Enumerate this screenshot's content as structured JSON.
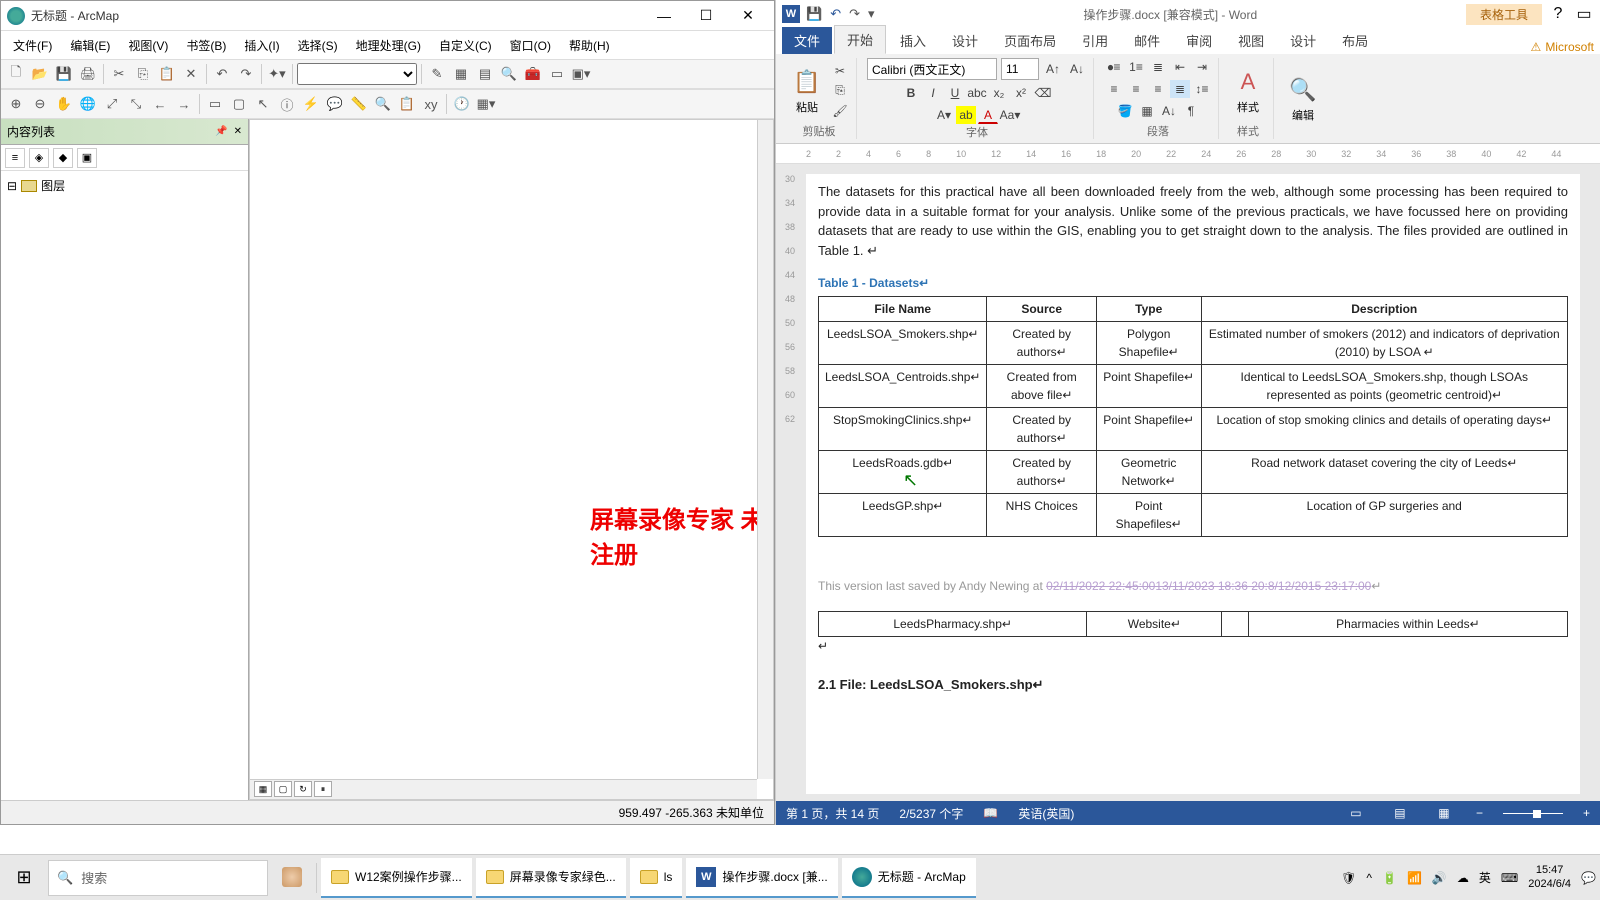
{
  "arcmap": {
    "title": "无标题 - ArcMap",
    "menu": {
      "file": "文件(F)",
      "edit": "编辑(E)",
      "view": "视图(V)",
      "bookmarks": "书签(B)",
      "insert": "插入(I)",
      "select": "选择(S)",
      "geoproc": "地理处理(G)",
      "custom": "自定义(C)",
      "window": "窗口(O)",
      "help": "帮助(H)"
    },
    "toc": {
      "title": "内容列表",
      "layers": "图层"
    },
    "status": "959.497 -265.363 未知单位",
    "watermark": "屏幕录像专家  未注册"
  },
  "word": {
    "doctitle": "操作步骤.docx [兼容模式] - Word",
    "tabtools": "表格工具",
    "signin": "Microsoft",
    "tabs": {
      "file": "文件",
      "home": "开始",
      "insert": "插入",
      "design": "设计",
      "layout": "页面布局",
      "ref": "引用",
      "mail": "邮件",
      "review": "审阅",
      "view": "视图",
      "tdesign": "设计",
      "tlayout": "布局"
    },
    "ribbon": {
      "clipboard": "剪贴板",
      "paste": "粘贴",
      "font": "字体",
      "para": "段落",
      "styles": "样式",
      "editing": "编辑",
      "fontname": "Calibri (西文正文)",
      "fontsize": "11"
    },
    "ruler_marks": [
      "2",
      "2",
      "4",
      "6",
      "8",
      "10",
      "12",
      "14",
      "16",
      "18",
      "20",
      "22",
      "24",
      "26",
      "28",
      "30",
      "32",
      "34",
      "36",
      "38",
      "40",
      "42",
      "44"
    ],
    "vruler": [
      "30",
      "34",
      "38",
      "40",
      "44",
      "48",
      "50",
      "56",
      "58",
      "60",
      "62"
    ],
    "para": "The datasets for this practical have all been downloaded freely from the web, although some processing has been required to provide data in a suitable format for your analysis. Unlike some of the previous practicals, we have focussed here on providing datasets that are ready to use within the GIS, enabling you to get straight down to the analysis. The files provided are outlined in Table 1. ↵",
    "caption": "Table 1 - Datasets↵",
    "thead": {
      "file": "File Name",
      "src": "Source",
      "type": "Type",
      "desc": "Description"
    },
    "rows": [
      {
        "file": "LeedsLSOA_Smokers.shp↵",
        "src": "Created by authors↵",
        "type": "Polygon Shapefile↵",
        "desc": "Estimated number of smokers (2012) and indicators of deprivation (2010) by LSOA ↵"
      },
      {
        "file": "LeedsLSOA_Centroids.shp↵",
        "src": "Created from above file↵",
        "type": "Point Shapefile↵",
        "desc": "Identical to LeedsLSOA_Smokers.shp, though LSOAs represented as points (geometric centroid)↵"
      },
      {
        "file": "StopSmokingClinics.shp↵",
        "src": "Created by authors↵",
        "type": "Point Shapefile↵",
        "desc": "Location of stop smoking clinics and details of operating days↵"
      },
      {
        "file": "LeedsRoads.gdb↵",
        "src": "Created by authors↵",
        "type": "Geometric Network↵",
        "desc": "Road network dataset covering the city of Leeds↵"
      },
      {
        "file": "LeedsGP.shp↵",
        "src": "NHS Choices",
        "type": "Point Shapefiles↵",
        "desc": "Location of GP surgeries and"
      }
    ],
    "foot_pre": "This version last saved by Andy Newing at ",
    "foot_strike": "02/11/2022 22:45:0013/11/2023 18:36 20:8/12/2015 23:17:00",
    "row2": {
      "file": "LeedsPharmacy.shp↵",
      "src": "Website↵",
      "type": "",
      "desc": "Pharmacies within Leeds↵"
    },
    "sect": "2.1 File: LeedsLSOA_Smokers.shp↵",
    "status": {
      "page": "第 1 页，共 14 页",
      "words": "2/5237 个字",
      "lang": "英语(英国)"
    }
  },
  "taskbar": {
    "search_ph": "搜索",
    "items": {
      "w12": "W12案例操作步骤...",
      "rec": "屏幕录像专家绿色...",
      "ls": "ls",
      "doc": "操作步骤.docx [兼...",
      "arc": "无标题 - ArcMap"
    },
    "ime": "英",
    "clock_time": "15:47",
    "clock_date": "2024/6/4"
  }
}
